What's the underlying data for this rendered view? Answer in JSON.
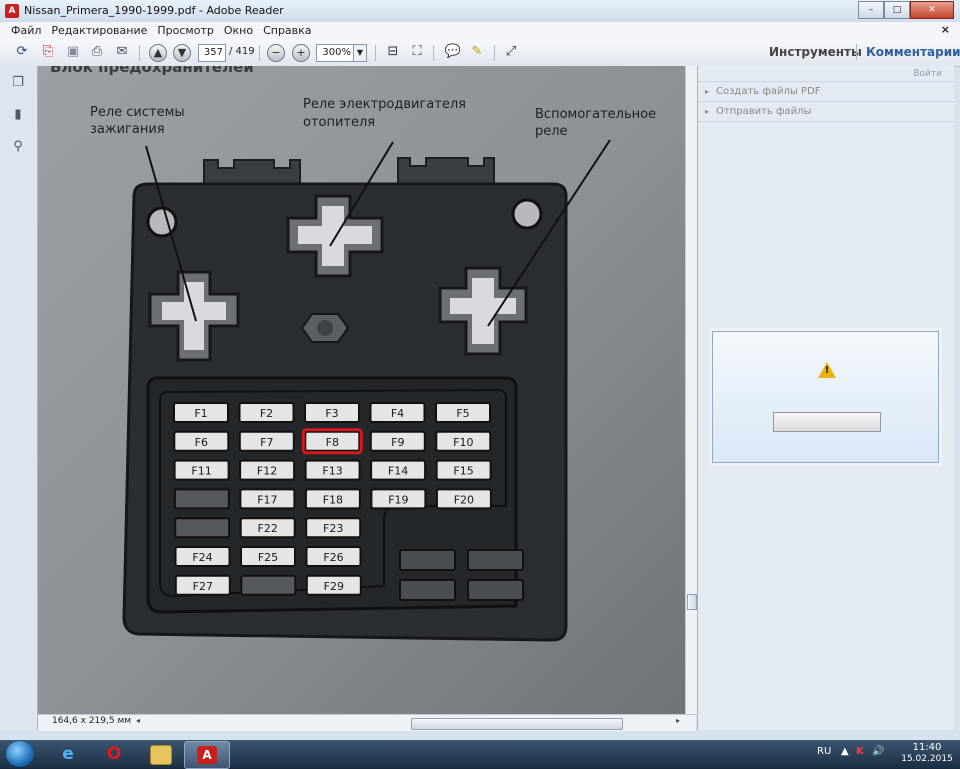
{
  "window": {
    "title": "Nissan_Primera_1990-1999.pdf - Adobe Reader",
    "controls": {
      "minimize": "–",
      "maximize": "□",
      "close": "✕"
    }
  },
  "menu": {
    "items": [
      "Файл",
      "Редактирование",
      "Просмотр",
      "Окно",
      "Справка"
    ],
    "close_doc": "×"
  },
  "toolbar": {
    "page_number": "357",
    "page_total": "/ 419",
    "zoom": "300%",
    "tools_label": "Инструменты",
    "comments_label": "Комментарии"
  },
  "document": {
    "heading_fragment": "Блок предохранителей",
    "labels": {
      "ignition_relay": "Реле системы\nзажигания",
      "heater_relay": "Реле электродвигателя\nотопителя",
      "aux_relay": "Вспомогательное\nреле"
    },
    "fuse_rows": [
      [
        "F1",
        "F2",
        "F3",
        "F4",
        "F5"
      ],
      [
        "F6",
        "F7",
        "F8",
        "F9",
        "F10"
      ],
      [
        "F11",
        "F12",
        "F13",
        "F14",
        "F15"
      ],
      [
        "",
        "F17",
        "F18",
        "F19",
        "F20"
      ],
      [
        "",
        "F22",
        "F23"
      ],
      [
        "F24",
        "F25",
        "F26"
      ],
      [
        "F27",
        "",
        "F29"
      ]
    ],
    "highlighted_fuse": "F8",
    "highlight_color": "#d8191c"
  },
  "status": {
    "page_size": "164,6 x 219,5 мм"
  },
  "right_panel": {
    "signin": "Войти",
    "items": [
      "Создать файлы PDF",
      "Отправить файлы"
    ]
  },
  "taskbar": {
    "apps": [
      "windows-start",
      "internet-explorer",
      "opera",
      "file-explorer",
      "adobe-reader"
    ],
    "language": "RU",
    "time": "11:40",
    "date": "15.02.2015"
  }
}
